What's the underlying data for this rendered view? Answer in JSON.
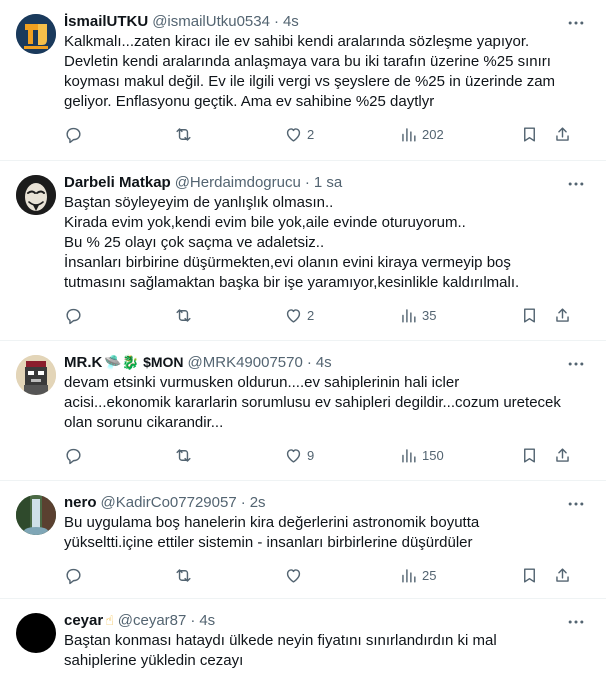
{
  "tweets": [
    {
      "name": "İsmailUTKU",
      "emoji": "",
      "handle": "@ismailUtku0534",
      "time": "4s",
      "text": "Kalkmalı...zaten kiracı ile ev sahibi kendi aralarında sözleşme yapıyor.\nDevletin kendi aralarında anlaşmaya vara  bu iki tarafın üzerine %25 sınırı\nkoyması makul değil. Ev ile ilgili vergi vs şeyslere de %25  in üzerinde zam\ngeliyor. Enflasyonu geçtik. Ama ev sahibine %25 daytlyr",
      "replies": "",
      "retweets": "",
      "likes": "2",
      "views": "202",
      "avatar_color": "#1a3a5c"
    },
    {
      "name": "Darbeli Matkap",
      "emoji": "",
      "handle": "@Herdaimdogrucu",
      "time": "1 sa",
      "text": "Baştan söyleyeyim de yanlışlık olmasın..\nKirada evim yok,kendi evim bile yok,aile evinde oturuyorum..\nBu % 25 olayı çok saçma ve adaletsiz..\nİnsanları birbirine düşürmekten,evi olanın evini kiraya vermeyip boş\ntutmasını sağlamaktan başka bir işe yaramıyor,kesinlikle kaldırılmalı.",
      "replies": "",
      "retweets": "",
      "likes": "2",
      "views": "35",
      "avatar_color": "#222222"
    },
    {
      "name": "MR.K",
      "emoji": "🛸🐉 $MON",
      "handle": "@MRK49007570",
      "time": "4s",
      "text": "devam etsinki vurmusken oldurun....ev sahiplerinin hali icler\nacisi...ekonomik kararlarin sorumlusu ev sahipleri degildir...cozum uretecek\nolan sorunu cikarandir...",
      "replies": "",
      "retweets": "",
      "likes": "9",
      "views": "150",
      "avatar_color": "#d9c7a8"
    },
    {
      "name": "nero",
      "emoji": "",
      "handle": "@KadirCo07729057",
      "time": "2s",
      "text": "Bu uygulama boş hanelerin kira değerlerini astronomik boyutta\nyükseltti.içine ettiler sistemin - insanları birbirlerine düşürdüler",
      "replies": "",
      "retweets": "",
      "likes": "",
      "views": "25",
      "avatar_color": "#3d5a3a"
    },
    {
      "name": "ceyar",
      "emoji": "☝",
      "handle": "@ceyar87",
      "time": "4s",
      "text": "Baştan konması hataydı ülkede neyin fiyatını sınırlandırdın ki mal\nsahiplerine yükledin cezayı",
      "replies": "",
      "retweets": "",
      "likes": "",
      "views": "",
      "avatar_color": "#000000"
    }
  ],
  "icons": {
    "reply": "reply-icon",
    "retweet": "retweet-icon",
    "like": "heart-icon",
    "views": "views-icon",
    "bookmark": "bookmark-icon",
    "share": "share-icon",
    "more": "more-icon"
  }
}
